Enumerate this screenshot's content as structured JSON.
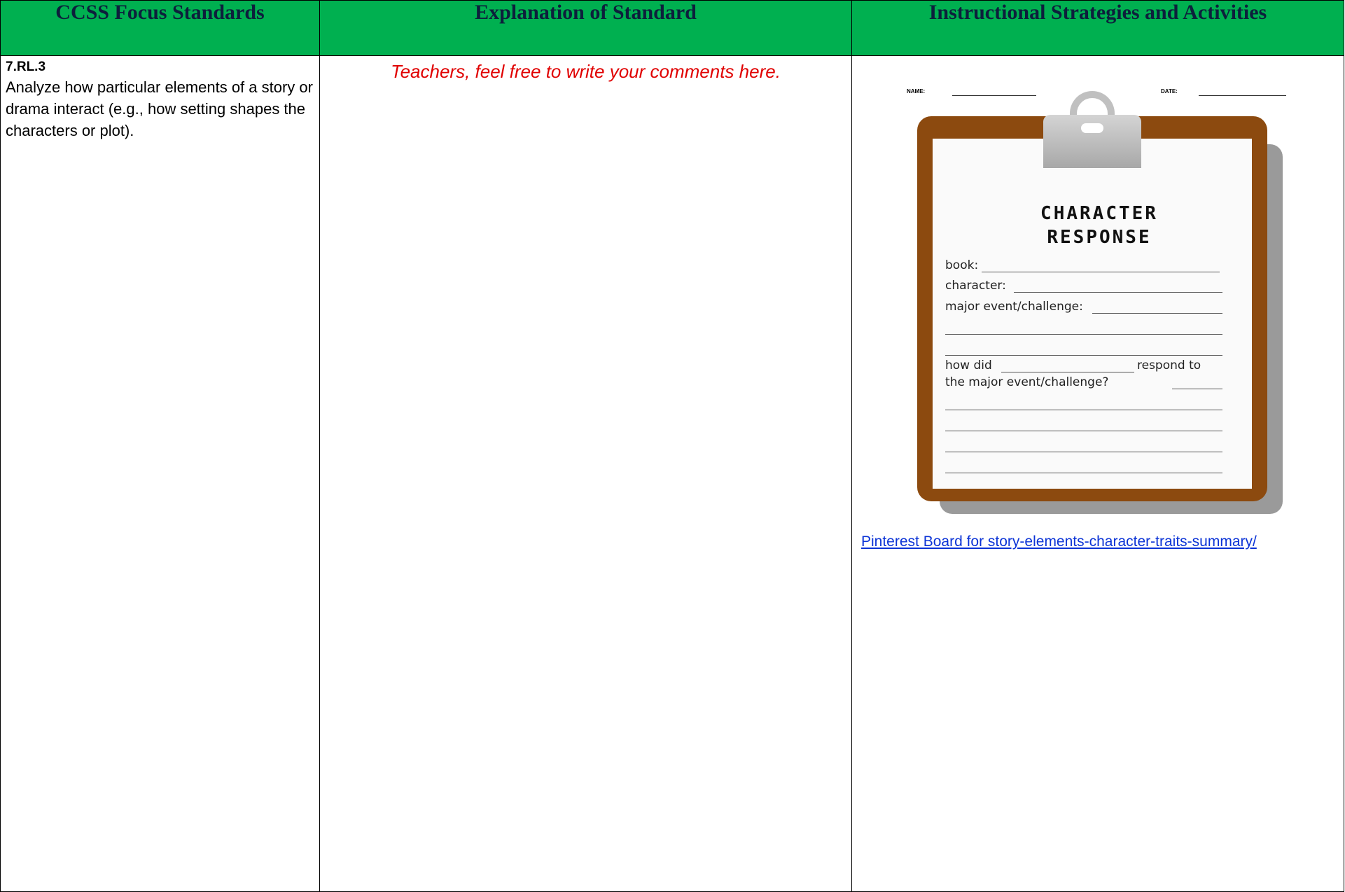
{
  "table": {
    "headers": [
      "CCSS Focus Standards",
      "Explanation of Standard",
      "Instructional Strategies and Activities"
    ],
    "standard": {
      "code": "7.RL.3",
      "text": "Analyze how particular elements of a story or drama interact (e.g., how setting shapes the characters or plot)."
    },
    "explanation": "Teachers, feel free to write your comments here.",
    "activity": {
      "worksheet": {
        "name_label": "NAME:",
        "date_label": "DATE:",
        "title_line1": "CHARACTER",
        "title_line2": "RESPONSE",
        "fields": {
          "book": "book:",
          "character": "character:",
          "major_event": "major event/challenge:",
          "how_did": "how did",
          "respond_to": "respond to",
          "major_question": "the major event/challenge?"
        }
      },
      "link_text": "Pinterest Board for story-elements-character-traits-summary/"
    }
  },
  "colors": {
    "header_bg": "#00b050",
    "note_text": "#e00000",
    "link": "#0b33d6",
    "clipboard": "#8c4a0f"
  }
}
